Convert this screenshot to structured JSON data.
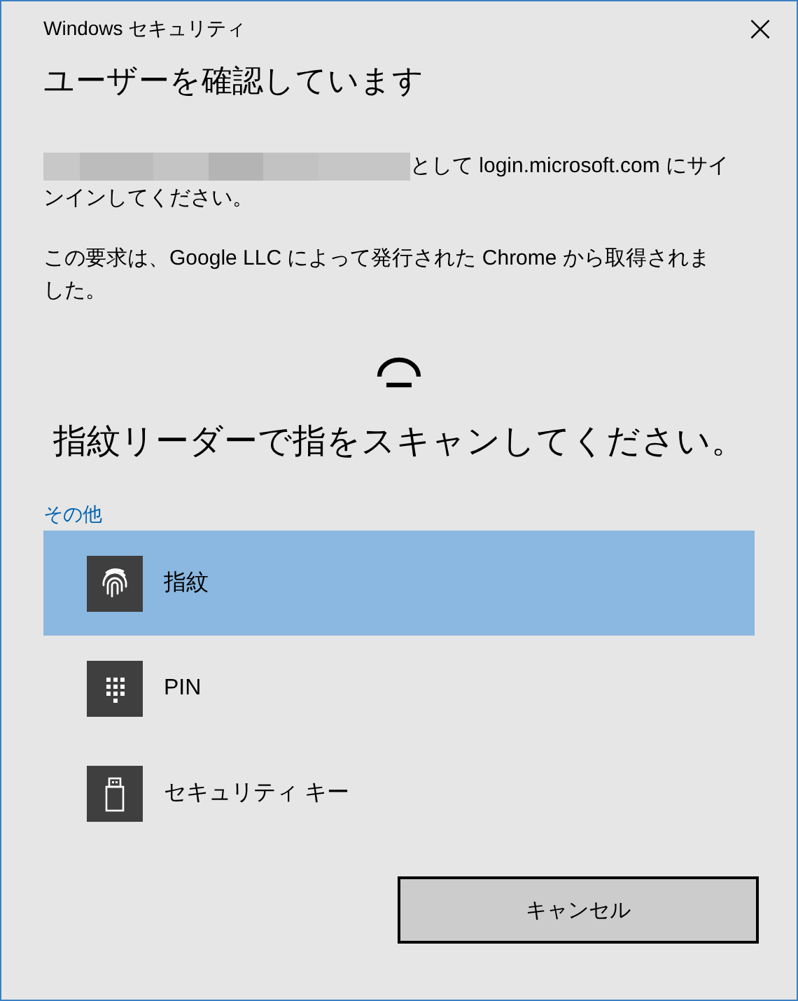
{
  "window": {
    "title": "Windows セキュリティ",
    "close": "×"
  },
  "heading": "ユーザーを確認しています",
  "sign_in_lines": [
    "として login.microsoft.com にサイ",
    "ンインしてください。"
  ],
  "request_text": "この要求は、Google LLC によって発行された Chrome から取得されました。",
  "prompt": "指紋リーダーで指をスキャンしてください。",
  "more_label": "その他",
  "options": [
    {
      "kind": "fingerprint",
      "label": "指紋",
      "selected": true
    },
    {
      "kind": "keypad",
      "label": "PIN",
      "selected": false
    },
    {
      "kind": "usb",
      "label": "セキュリティ キー",
      "selected": false
    }
  ],
  "buttons": [
    "キャンセル"
  ]
}
